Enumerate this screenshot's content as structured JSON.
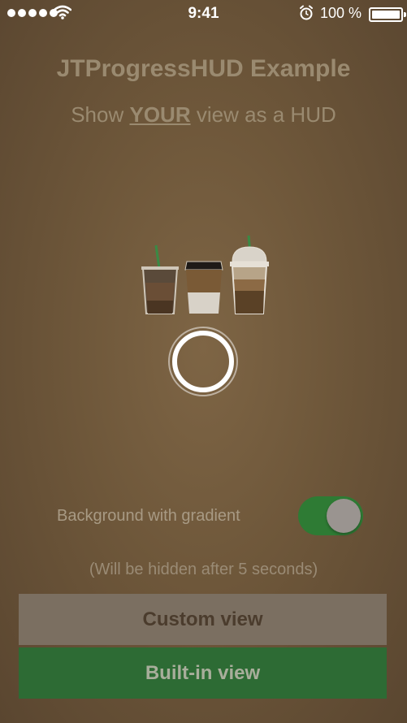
{
  "status_bar": {
    "time": "9:41",
    "battery_text": "100 %",
    "icons": [
      "signal-dots-icon",
      "wifi-icon",
      "alarm-icon",
      "battery-icon"
    ]
  },
  "header": {
    "title": "JTProgressHUD Example",
    "subtitle_prefix": "Show ",
    "subtitle_emphasis": "YOUR",
    "subtitle_suffix": " view as a HUD"
  },
  "hud": {
    "image": "coffee-cups-illustration",
    "spinner": "progress-spinner-icon"
  },
  "options": {
    "gradient_label": "Background with gradient",
    "gradient_enabled": true
  },
  "hint": "(Will be hidden after 5 seconds)",
  "buttons": {
    "custom_label": "Custom view",
    "builtin_label": "Built-in view"
  },
  "colors": {
    "accent_green": "#2e7b34",
    "background": "#6e573a"
  }
}
